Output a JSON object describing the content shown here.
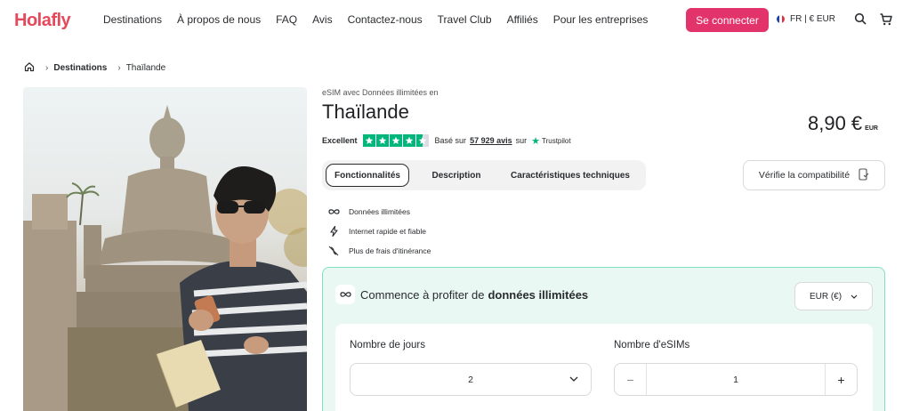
{
  "header": {
    "logo": "Holafly",
    "nav": [
      "Destinations",
      "À propos de nous",
      "FAQ",
      "Avis",
      "Contactez-nous",
      "Travel Club",
      "Affiliés",
      "Pour les entreprises"
    ],
    "login_label": "Se connecter",
    "locale": "FR | € EUR",
    "colors": {
      "brand": "#e6485c",
      "button": "#e2336b"
    },
    "icons": [
      "france-flag-icon",
      "search-icon",
      "cart-icon"
    ]
  },
  "breadcrumb": {
    "items": [
      "Destinations",
      "Thaïlande"
    ],
    "home_icon": "home-icon"
  },
  "product": {
    "subtitle": "eSIM avec Données illimitées en",
    "title": "Thaïlande",
    "price": "8,90 €",
    "price_unit": "EUR",
    "rating": {
      "label": "Excellent",
      "stars": 4.5,
      "based_on": "Basé sur",
      "reviews": "57 929 avis",
      "on": "sur",
      "provider": "Trustpilot",
      "color": "#00b67a"
    },
    "tabs": [
      "Fonctionnalités",
      "Description",
      "Caractéristiques techniques"
    ],
    "active_tab": "Fonctionnalités",
    "compat_label": "Vérifie la compatibilité",
    "features": [
      {
        "icon": "infinity-icon",
        "label": "Données illimitées"
      },
      {
        "icon": "bolt-icon",
        "label": "Internet rapide et fiable"
      },
      {
        "icon": "no-roaming-icon",
        "label": "Plus de frais d'itinérance"
      }
    ]
  },
  "plan": {
    "heading_prefix": "Commence à profiter de",
    "heading_bold": "données illimitées",
    "currency": "EUR (€)",
    "days_label": "Nombre de jours",
    "days_value": "2",
    "esims_label": "Nombre d'eSIMs",
    "esims_value": "1",
    "minus": "−",
    "plus": "+",
    "colors": {
      "background": "#eaf8f3",
      "border": "#7fe0c1"
    }
  }
}
